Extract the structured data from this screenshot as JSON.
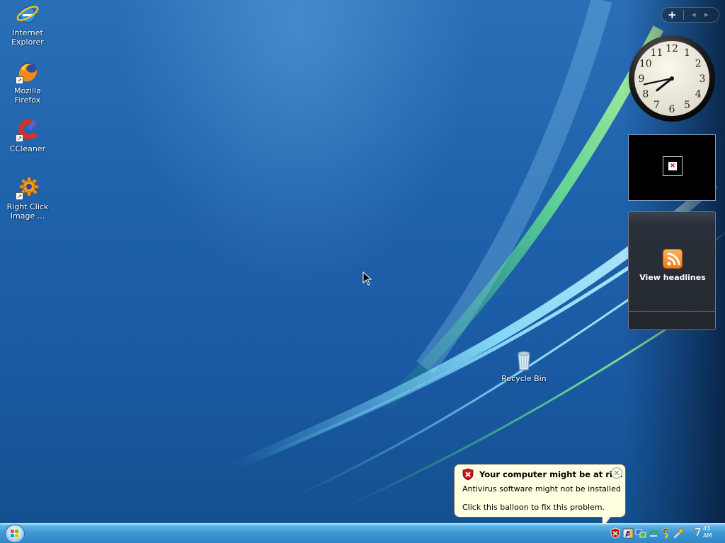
{
  "desktop": {
    "icons": [
      {
        "label_line1": "Internet",
        "label_line2": "Explorer",
        "icon": "internet-explorer-icon"
      },
      {
        "label_line1": "Mozilla Firefox",
        "label_line2": "",
        "icon": "firefox-icon"
      },
      {
        "label_line1": "CCleaner",
        "label_line2": "",
        "icon": "ccleaner-icon"
      },
      {
        "label_line1": "Right Click",
        "label_line2": "Image ...",
        "icon": "gear-icon"
      }
    ],
    "recycle_bin": {
      "label": "Recycle Bin",
      "icon": "recycle-bin-icon"
    }
  },
  "sidebar": {
    "controls": {
      "add": "+",
      "prev": "◂",
      "next": "▸"
    },
    "clock": {
      "numbers": [
        "12",
        "1",
        "2",
        "3",
        "4",
        "5",
        "6",
        "7",
        "8",
        "9",
        "10",
        "11"
      ],
      "hour": 7,
      "minute": 43
    },
    "slideshow": {
      "icon": "broken-image-icon",
      "broken_mark": "×"
    },
    "feed": {
      "label": "View headlines",
      "icon": "rss-icon"
    }
  },
  "balloon": {
    "title": "Your computer might be at risk",
    "line1": "Antivirus software might not be installed",
    "line2": "Click this balloon to fix this problem.",
    "close": "×",
    "icon": "security-shield-icon"
  },
  "taskbar": {
    "start_icon": "windows-logo-icon",
    "tray_icons": [
      "security-shield-icon",
      "font-a-icon",
      "network-icon",
      "update-arrow-icon",
      "swirl-icon",
      "tools-icon"
    ],
    "clock_hour": "7",
    "clock_minute": "43",
    "clock_ampm": "AM"
  },
  "colors": {
    "desktop_bg": "#1f63ad",
    "taskbar": "#3d96d2",
    "balloon_bg": "#ffffe1",
    "rss": "#f07a12"
  }
}
